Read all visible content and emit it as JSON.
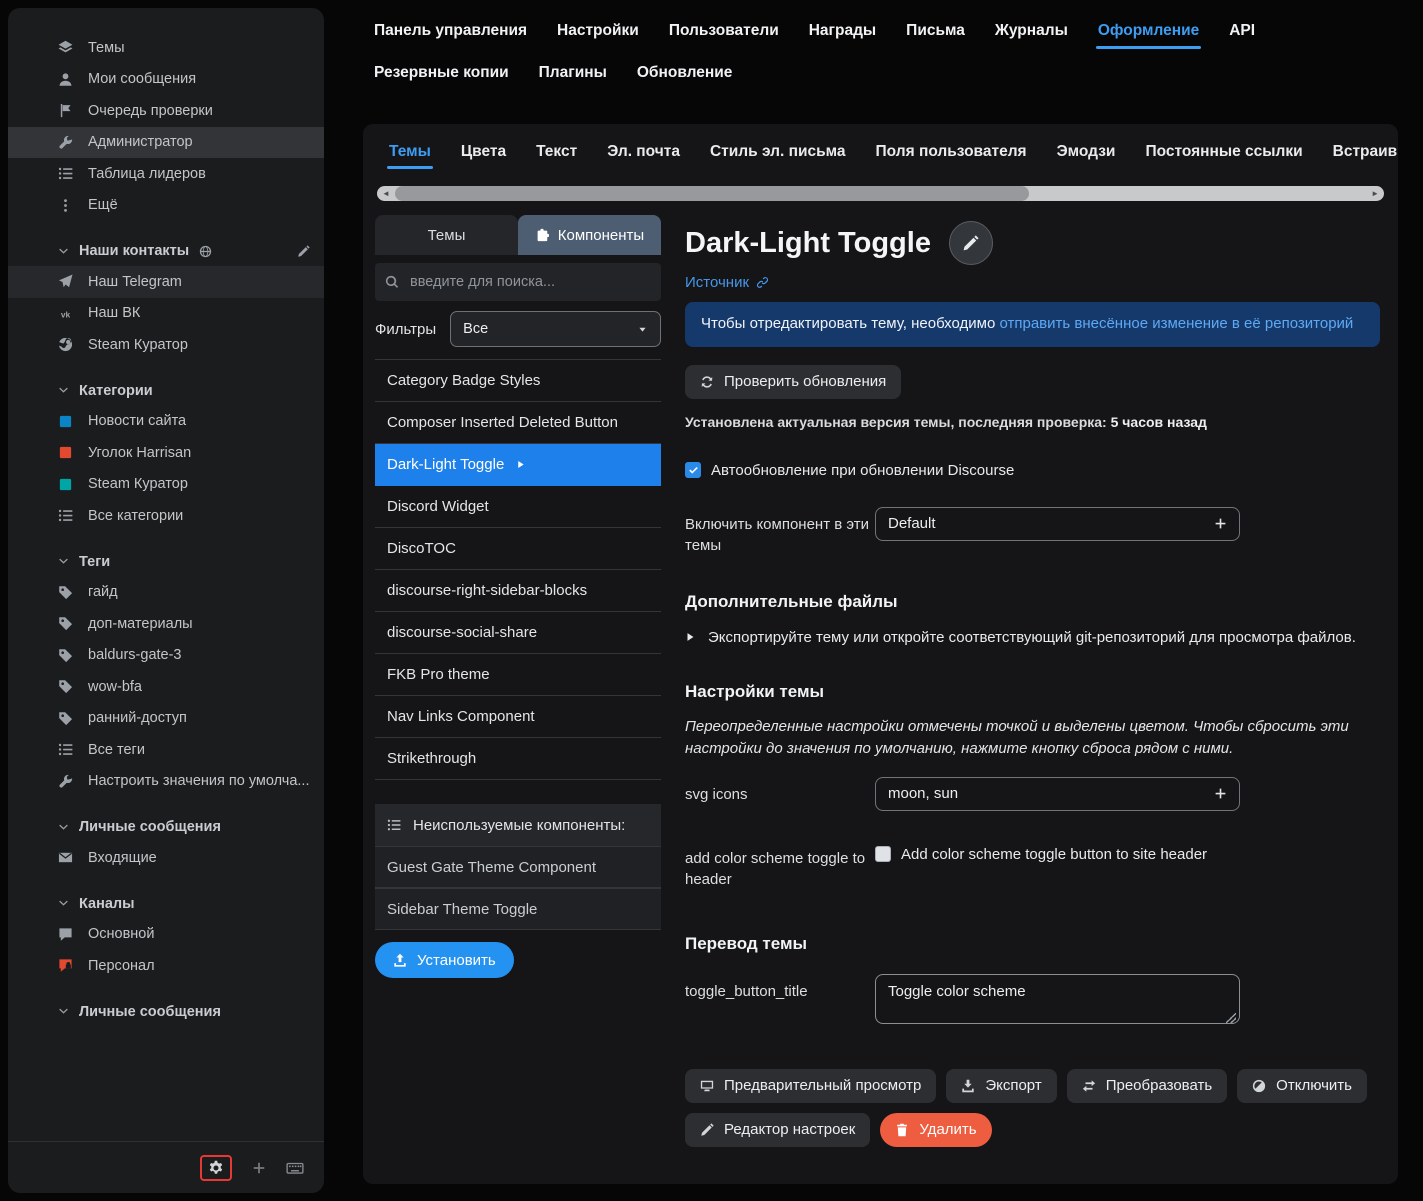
{
  "colors": {
    "accent": "#3d9df3",
    "selected_row": "#1e80ea",
    "danger": "#ef5d40",
    "info_background": "#16396b",
    "install_blue": "#2492f0",
    "highlight_ring_red": "#e53935"
  },
  "sidebar": {
    "groups": [
      {
        "items": [
          {
            "icon": "layers-icon",
            "label": "Темы"
          },
          {
            "icon": "user-icon",
            "label": "Мои сообщения"
          },
          {
            "icon": "flag-icon",
            "label": "Очередь проверки"
          },
          {
            "icon": "wrench-icon",
            "label": "Администратор",
            "state": "active"
          },
          {
            "icon": "leaderboard-icon",
            "label": "Таблица лидеров"
          },
          {
            "icon": "ellipsis-icon",
            "label": "Ещё"
          }
        ]
      },
      {
        "header": {
          "label": "Наши контакты",
          "icons": [
            "globe-icon",
            "pencil-icon"
          ]
        },
        "items": [
          {
            "icon": "telegram-icon",
            "label": "Наш Telegram",
            "state": "hover"
          },
          {
            "icon": "vk-icon",
            "label": "Наш ВК"
          },
          {
            "icon": "steam-icon",
            "label": "Steam Куратор"
          }
        ]
      },
      {
        "header": {
          "label": "Категории"
        },
        "items": [
          {
            "icon": "category-swatch",
            "color": "#0a84c4",
            "label": "Новости сайта"
          },
          {
            "icon": "category-swatch",
            "color": "#e2492f",
            "label": "Уголок Harrisan"
          },
          {
            "icon": "category-swatch",
            "color": "#00a6a6",
            "label": "Steam Куратор"
          },
          {
            "icon": "list-icon",
            "label": "Все категории"
          }
        ]
      },
      {
        "header": {
          "label": "Теги"
        },
        "items": [
          {
            "icon": "tag-icon",
            "label": "гайд"
          },
          {
            "icon": "tag-icon",
            "label": "доп-материалы"
          },
          {
            "icon": "tag-icon",
            "label": "baldurs-gate-3"
          },
          {
            "icon": "tag-icon",
            "label": "wow-bfa"
          },
          {
            "icon": "tag-icon",
            "label": "ранний-доступ"
          },
          {
            "icon": "list-icon",
            "label": "Все теги"
          },
          {
            "icon": "wrench-icon",
            "label": "Настроить значения по умолча..."
          }
        ]
      },
      {
        "header": {
          "label": "Личные сообщения"
        },
        "items": [
          {
            "icon": "envelope-icon",
            "label": "Входящие"
          }
        ]
      },
      {
        "header": {
          "label": "Каналы"
        },
        "items": [
          {
            "icon": "comment-icon",
            "label": "Основной"
          },
          {
            "icon": "comment-lock-icon",
            "color": "#e2492f",
            "label": "Персонал"
          }
        ]
      },
      {
        "header": {
          "label": "Личные сообщения"
        },
        "items": []
      }
    ],
    "footer_icons": [
      "gear-icon",
      "plus-icon",
      "keyboard-icon"
    ],
    "footer_highlighted_icon": "gear-icon"
  },
  "admin_nav": {
    "row1": [
      {
        "label": "Панель управления"
      },
      {
        "label": "Настройки"
      },
      {
        "label": "Пользователи"
      },
      {
        "label": "Награды"
      },
      {
        "label": "Письма"
      },
      {
        "label": "Журналы"
      },
      {
        "label": "Оформление",
        "active": true
      },
      {
        "label": "API"
      }
    ],
    "row2": [
      {
        "label": "Резервные копии"
      },
      {
        "label": "Плагины"
      },
      {
        "label": "Обновление"
      }
    ]
  },
  "panel": {
    "tabs": [
      {
        "label": "Темы",
        "active": true
      },
      {
        "label": "Цвета"
      },
      {
        "label": "Текст"
      },
      {
        "label": "Эл. почта"
      },
      {
        "label": "Стиль эл. письма"
      },
      {
        "label": "Поля пользователя"
      },
      {
        "label": "Эмодзи"
      },
      {
        "label": "Постоянные ссылки"
      },
      {
        "label": "Встраив"
      }
    ],
    "list": {
      "tabs": [
        {
          "label": "Темы"
        },
        {
          "label": "Компоненты",
          "active": true,
          "icon": "puzzle-icon"
        }
      ],
      "search_placeholder": "введите для поиска...",
      "filters_label": "Фильтры",
      "filters_value": "Все",
      "components": [
        "Category Badge Styles",
        "Composer Inserted Deleted Button",
        "Dark-Light Toggle",
        "Discord Widget",
        "DiscoTOC",
        "discourse-right-sidebar-blocks",
        "discourse-social-share",
        "FKB Pro theme",
        "Nav Links Component",
        "Strikethrough"
      ],
      "selected": "Dark-Light Toggle",
      "unused_header": "Неиспользуемые компоненты:",
      "unused": [
        "Guest Gate Theme Component",
        "Sidebar Theme Toggle"
      ],
      "install_label": "Установить"
    },
    "detail": {
      "title": "Dark-Light Toggle",
      "source_label": "Источник",
      "info_text": "Чтобы отредактировать тему, необходимо ",
      "info_link": "отправить внесённое изменение в её репозиторий",
      "check_updates_label": "Проверить обновления",
      "status_text": "Установлена актуальная версия темы, последняя проверка: ",
      "status_time": "5 часов назад",
      "autoupdate_label": "Автообновление при обновлении Discourse",
      "include_label": "Включить компонент в эти темы",
      "include_value": "Default",
      "extra_files_heading": "Дополнительные файлы",
      "extra_files_text": "Экспортируйте тему или откройте соответствующий git-репозиторий для просмотра файлов.",
      "settings_heading": "Настройки темы",
      "settings_note": "Переопределенные настройки отмечены точкой и выделены цветом. Чтобы сбросить эти настройки до значения по умолчанию, нажмите кнопку сброса рядом с ними.",
      "svg_icons_label": "svg icons",
      "svg_icons_value": "moon, sun",
      "color_toggle_label": "add color scheme toggle to header",
      "color_toggle_checkbox": "Add color scheme toggle button to site header",
      "translation_heading": "Перевод темы",
      "translation_key": "toggle_button_title",
      "translation_value": "Toggle color scheme",
      "buttons": {
        "preview": "Предварительный просмотр",
        "export": "Экспорт",
        "convert": "Преобразовать",
        "disable": "Отключить",
        "settings_editor": "Редактор настроек",
        "delete": "Удалить"
      }
    }
  }
}
